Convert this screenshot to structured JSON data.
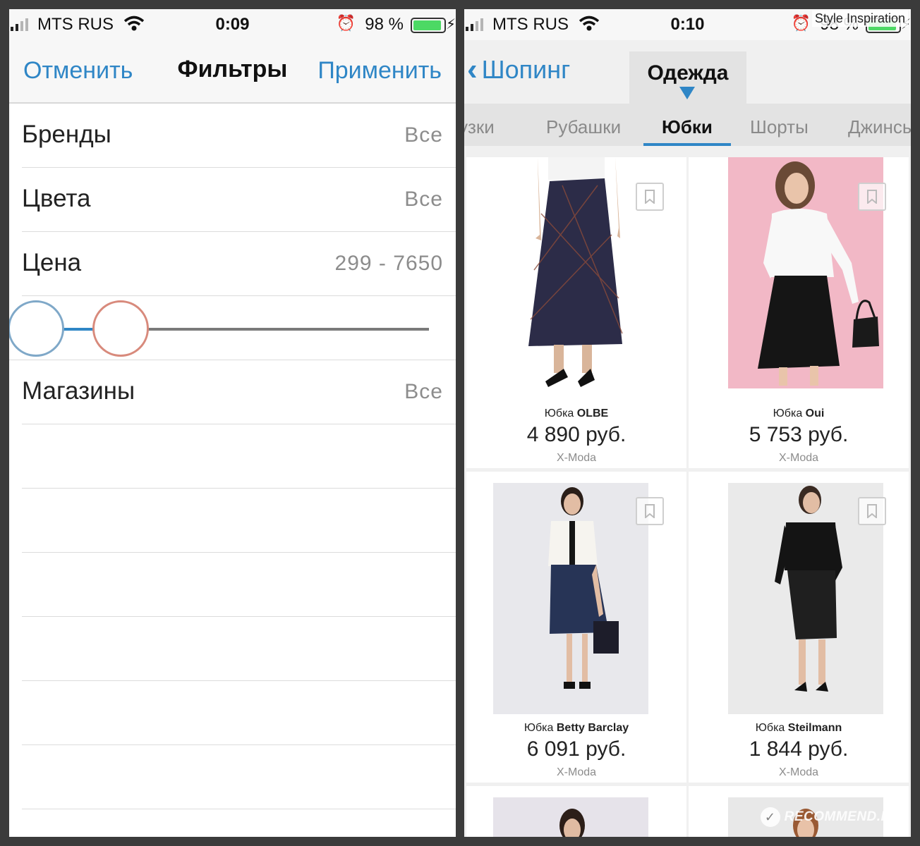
{
  "watermarks": {
    "top": "Style Inspiration",
    "bottom": "RECOMMEND.RU"
  },
  "colors": {
    "accent": "#2f86c6",
    "battery": "#4cd964",
    "slider_min_thumb": "#7fa8c8",
    "slider_max_thumb": "#d88a7c"
  },
  "left_screen": {
    "status": {
      "carrier": "MTS RUS",
      "time": "0:09",
      "battery": "98 %"
    },
    "nav": {
      "cancel": "Отменить",
      "title": "Фильтры",
      "apply": "Применить"
    },
    "filters": [
      {
        "label": "Бренды",
        "value": "Все"
      },
      {
        "label": "Цвета",
        "value": "Все"
      },
      {
        "label": "Цена",
        "value": "299 - 7650"
      },
      {
        "label": "Магазины",
        "value": "Все"
      }
    ],
    "price_slider": {
      "min": 299,
      "max": 7650
    }
  },
  "right_screen": {
    "status": {
      "carrier": "MTS RUS",
      "time": "0:10",
      "battery": "98 %"
    },
    "nav": {
      "back": "Шопинг",
      "category": "Одежда"
    },
    "subtabs": [
      "узки",
      "Рубашки",
      "Юбки",
      "Шорты",
      "Джинсы"
    ],
    "active_subtab": "Юбки",
    "products": [
      {
        "type": "Юбка",
        "brand": "OLBE",
        "price": "4 890 руб.",
        "shop": "X-Moda"
      },
      {
        "type": "Юбка",
        "brand": "Oui",
        "price": "5 753 руб.",
        "shop": "X-Moda"
      },
      {
        "type": "Юбка",
        "brand": "Betty Barclay",
        "price": "6 091 руб.",
        "shop": "X-Moda"
      },
      {
        "type": "Юбка",
        "brand": "Steilmann",
        "price": "1 844 руб.",
        "shop": "X-Moda"
      }
    ]
  },
  "icons": {
    "signal": "signal-icon",
    "wifi": "wifi-icon",
    "alarm": "alarm-icon",
    "battery": "battery-icon",
    "charging": "charging-icon",
    "back": "chevron-left-icon",
    "bookmark": "bookmark-icon"
  }
}
